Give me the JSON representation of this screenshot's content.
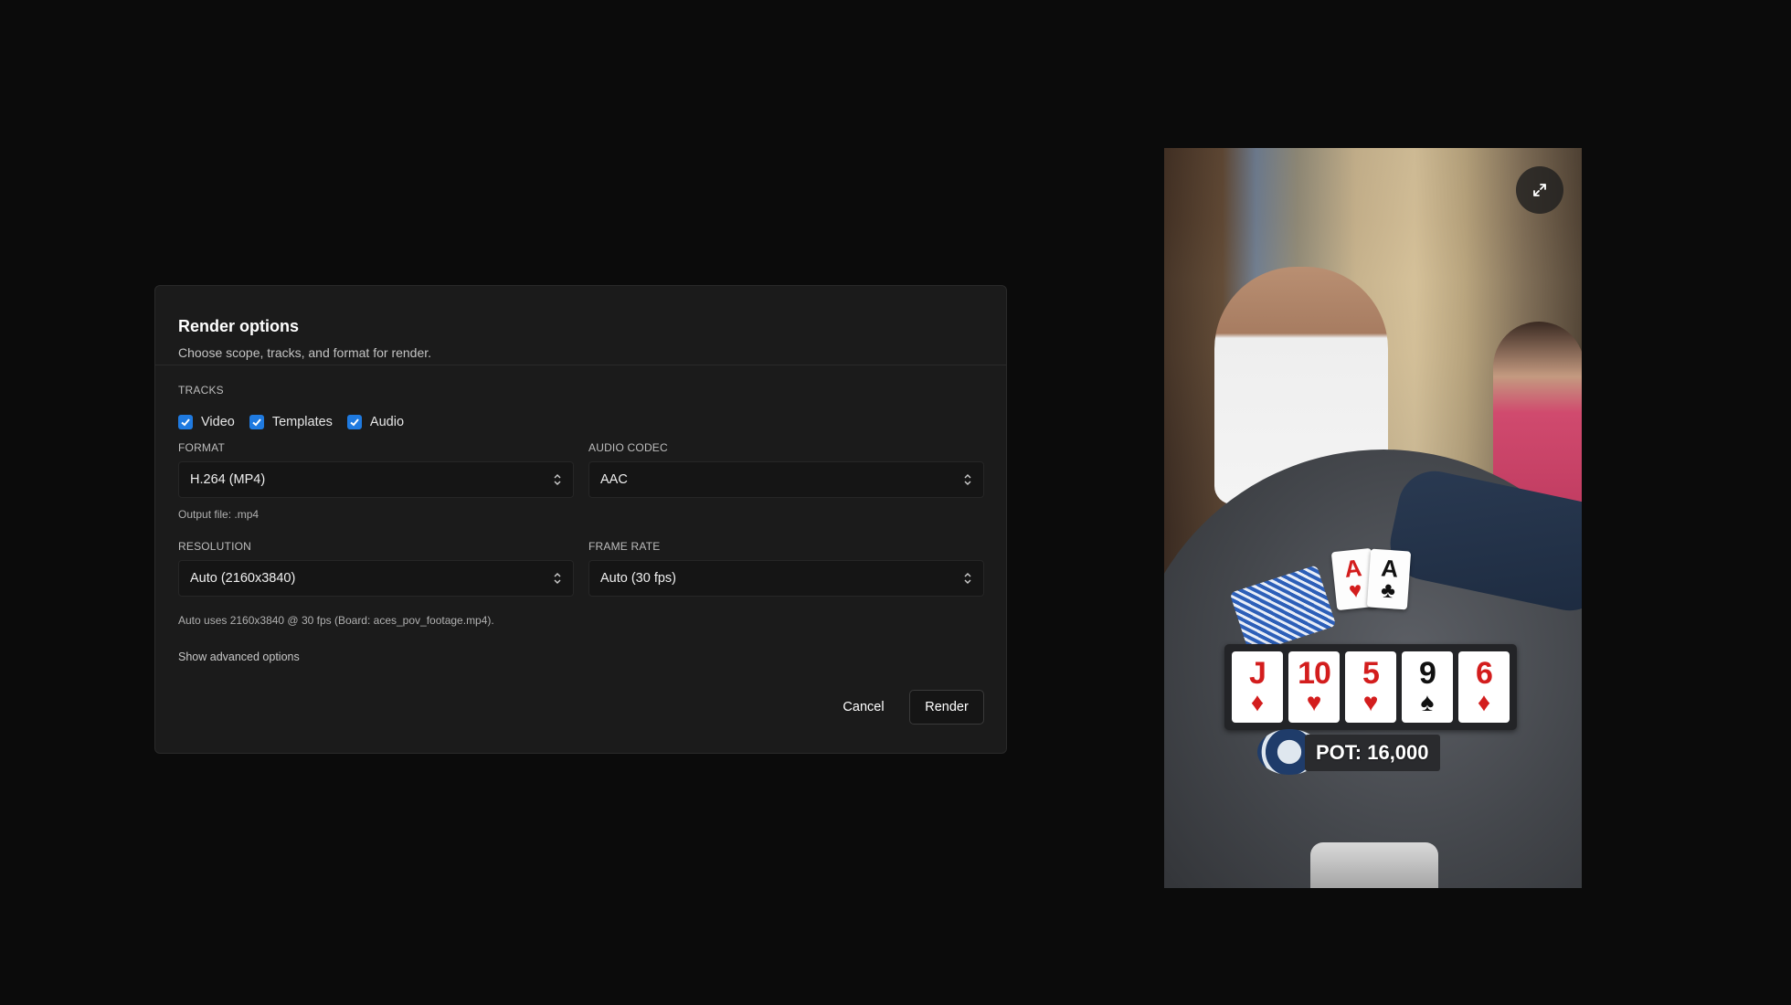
{
  "dialog": {
    "title": "Render options",
    "subtitle": "Choose scope, tracks, and format for render.",
    "tracks": {
      "label": "TRACKS",
      "items": [
        {
          "label": "Video",
          "checked": true
        },
        {
          "label": "Templates",
          "checked": true
        },
        {
          "label": "Audio",
          "checked": true
        }
      ]
    },
    "format": {
      "label": "FORMAT",
      "value": "H.264 (MP4)",
      "hint": "Output file: .mp4"
    },
    "audio_codec": {
      "label": "AUDIO CODEC",
      "value": "AAC"
    },
    "resolution": {
      "label": "RESOLUTION",
      "value": "Auto (2160x3840)"
    },
    "frame_rate": {
      "label": "FRAME RATE",
      "value": "Auto (30 fps)"
    },
    "auto_hint": "Auto uses 2160x3840 @ 30 fps (Board: aces_pov_footage.mp4).",
    "advanced_link": "Show advanced options",
    "cancel_label": "Cancel",
    "render_label": "Render",
    "accent_color": "#1f7ae0"
  },
  "preview": {
    "expand_icon": "expand-icon",
    "hole_cards": [
      {
        "rank": "A",
        "suit": "♥",
        "color": "red"
      },
      {
        "rank": "A",
        "suit": "♣",
        "color": "black"
      }
    ],
    "board_cards": [
      {
        "rank": "J",
        "suit": "♦",
        "color": "red"
      },
      {
        "rank": "10",
        "suit": "♥",
        "color": "red"
      },
      {
        "rank": "5",
        "suit": "♥",
        "color": "red"
      },
      {
        "rank": "9",
        "suit": "♠",
        "color": "black"
      },
      {
        "rank": "6",
        "suit": "♦",
        "color": "red"
      }
    ],
    "pot_text": "POT: 16,000"
  }
}
